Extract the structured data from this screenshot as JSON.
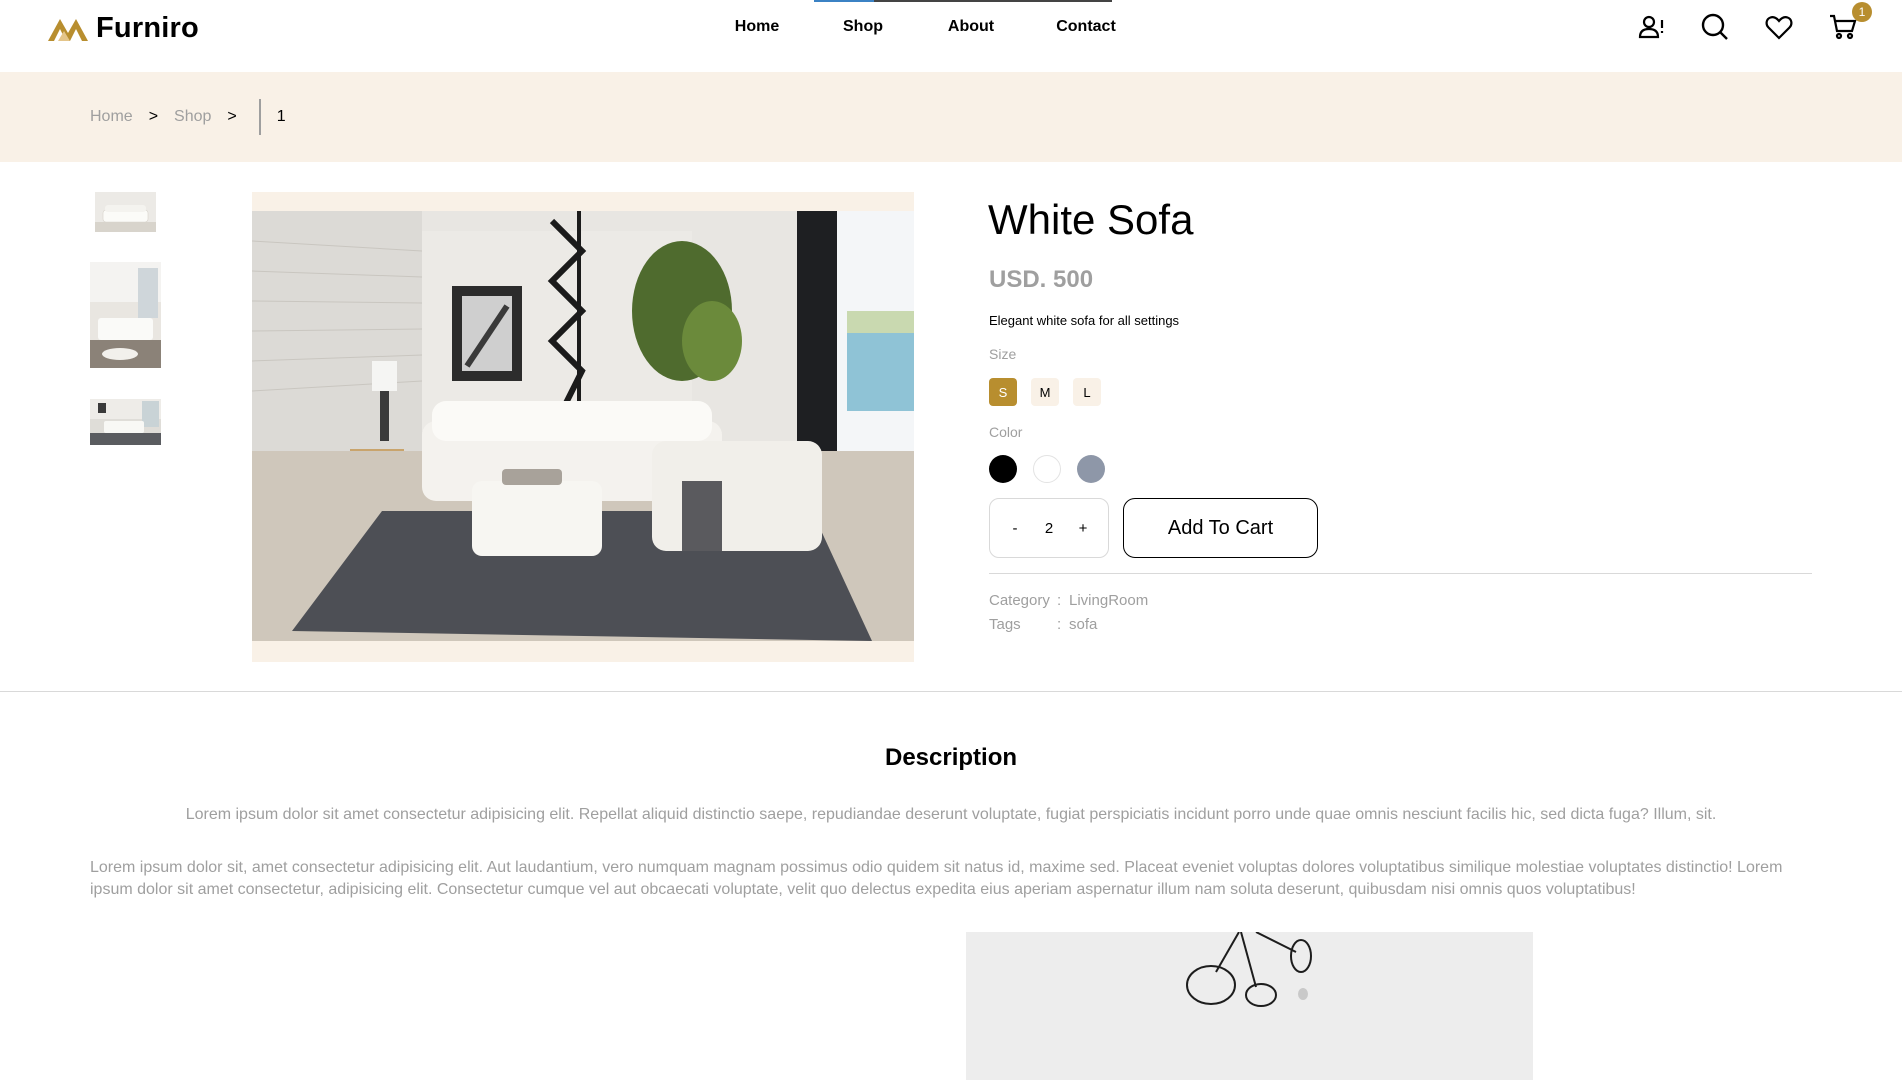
{
  "brand": {
    "name": "Furniro",
    "accent": "#b88e2f",
    "logo_icon": "furniro-logo-icon"
  },
  "nav": {
    "items": [
      {
        "label": "Home",
        "active": false
      },
      {
        "label": "Shop",
        "active": true
      },
      {
        "label": "About",
        "active": false
      },
      {
        "label": "Contact",
        "active": false
      }
    ]
  },
  "header_icons": {
    "account": "account-alert-icon",
    "search": "search-icon",
    "wishlist": "heart-icon",
    "cart": "cart-icon",
    "cart_count": "1"
  },
  "breadcrumb": {
    "home": "Home",
    "shop": "Shop",
    "separator": ">",
    "current": "1"
  },
  "product": {
    "title": "White Sofa",
    "price": "USD. 500",
    "description": "Elegant white sofa for all settings",
    "size_label": "Size",
    "sizes": [
      "S",
      "M",
      "L"
    ],
    "selected_size": "S",
    "color_label": "Color",
    "colors": [
      "#000000",
      "#ffffff",
      "#8e97a8"
    ],
    "quantity": {
      "minus": "-",
      "value": "2",
      "plus": "+"
    },
    "add_to_cart": "Add To Cart",
    "meta": {
      "category_key": "Category",
      "category_value": "LivingRoom",
      "tags_key": "Tags",
      "tags_value": "sofa",
      "colon": ":"
    }
  },
  "description": {
    "heading": "Description",
    "paragraph1": "Lorem ipsum dolor sit amet consectetur adipisicing elit. Repellat aliquid distinctio saepe, repudiandae deserunt voluptate, fugiat perspiciatis incidunt porro unde quae omnis nesciunt facilis hic, sed dicta fuga? Illum, sit.",
    "paragraph2": "Lorem ipsum dolor sit, amet consectetur adipisicing elit. Aut laudantium, vero numquam magnam possimus odio quidem sit natus id, maxime sed. Placeat eveniet voluptas dolores voluptatibus similique molestiae voluptates distinctio! Lorem ipsum dolor sit amet consectetur, adipisicing elit. Consectetur cumque vel aut obcaecati voluptate, velit quo delectus expedita eius aperiam aspernatur illum nam soluta deserunt, quibusdam nisi omnis quos voluptatibus!"
  }
}
